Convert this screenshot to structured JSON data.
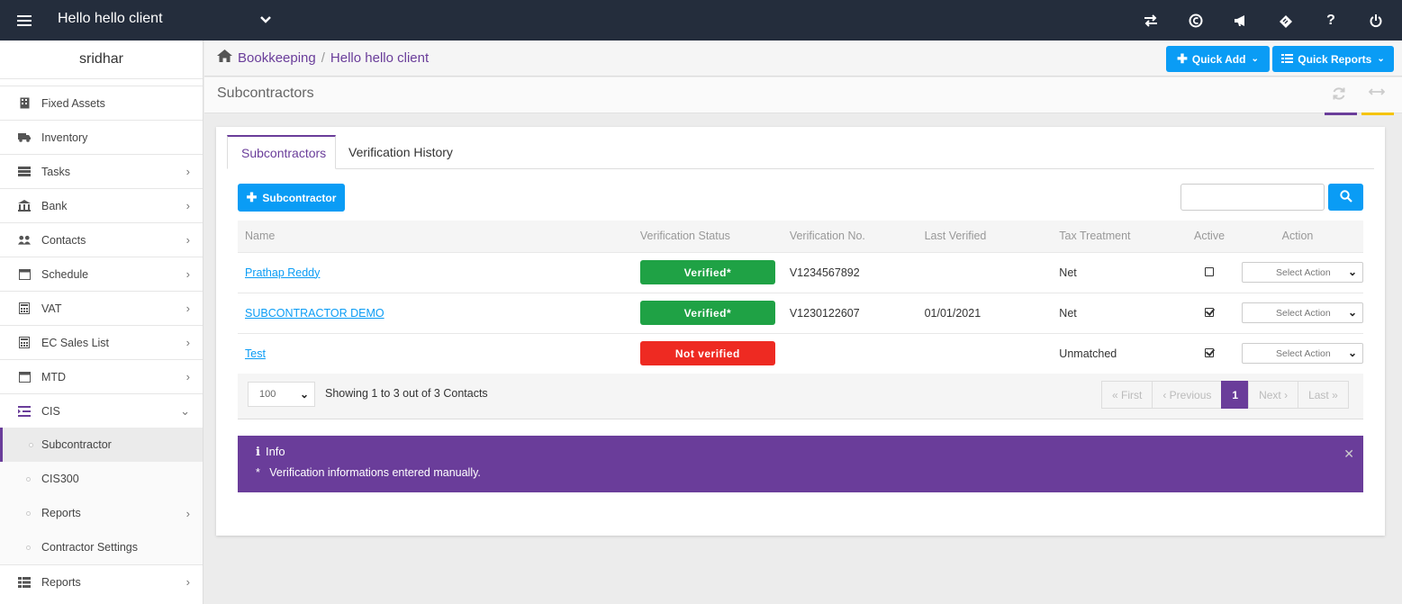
{
  "header": {
    "client_name": "Hello hello client",
    "icons": [
      "transfer-icon",
      "currency-icon",
      "announcement-icon",
      "ticket-icon",
      "help-icon",
      "power-icon"
    ]
  },
  "sidebar": {
    "user": "sridhar",
    "items": [
      {
        "label": "Fixed Assets",
        "icon": "building-icon",
        "has_chevron": false
      },
      {
        "label": "Inventory",
        "icon": "truck-icon",
        "has_chevron": false
      },
      {
        "label": "Tasks",
        "icon": "list-icon",
        "has_chevron": true
      },
      {
        "label": "Bank",
        "icon": "bank-icon",
        "has_chevron": true
      },
      {
        "label": "Contacts",
        "icon": "users-icon",
        "has_chevron": true
      },
      {
        "label": "Schedule",
        "icon": "calendar-icon",
        "has_chevron": true
      },
      {
        "label": "VAT",
        "icon": "calculator-icon",
        "has_chevron": true
      },
      {
        "label": "EC Sales List",
        "icon": "calculator-icon",
        "has_chevron": true
      },
      {
        "label": "MTD",
        "icon": "calendar-icon",
        "has_chevron": true
      },
      {
        "label": "CIS",
        "icon": "indent-icon",
        "has_chevron": true,
        "expanded": true
      }
    ],
    "cis_sub": [
      {
        "label": "Subcontractor",
        "active": true
      },
      {
        "label": "CIS300"
      },
      {
        "label": "Reports",
        "has_chevron": true
      },
      {
        "label": "Contractor Settings"
      }
    ],
    "bottom_item": {
      "label": "Reports",
      "icon": "table-icon"
    }
  },
  "breadcrumb": {
    "items": [
      "Bookkeeping",
      "Hello hello client"
    ],
    "separator": "/"
  },
  "toolbar": {
    "quick_add_label": "Quick Add",
    "quick_reports_label": "Quick Reports"
  },
  "page": {
    "title": "Subcontractors"
  },
  "tabs": [
    "Subcontractors",
    "Verification History"
  ],
  "actions": {
    "add_subcontractor_label": "Subcontractor"
  },
  "search": {
    "value": ""
  },
  "table": {
    "headers": [
      "Name",
      "Verification Status",
      "Verification No.",
      "Last Verified",
      "Tax Treatment",
      "Active",
      "Action"
    ],
    "rows": [
      {
        "name": "Prathap Reddy",
        "status": "Verified*",
        "status_color": "#1fa245",
        "verification_no": "V1234567892",
        "last_verified": "",
        "tax_treatment": "Net",
        "active": false,
        "action": "Select Action"
      },
      {
        "name": "SUBCONTRACTOR DEMO",
        "status": "Verified*",
        "status_color": "#1fa245",
        "verification_no": "V1230122607",
        "last_verified": "01/01/2021",
        "tax_treatment": "Net",
        "active": true,
        "action": "Select Action"
      },
      {
        "name": "Test",
        "status": "Not verified",
        "status_color": "#ee2a22",
        "verification_no": "",
        "last_verified": "",
        "tax_treatment": "Unmatched",
        "active": true,
        "action": "Select Action"
      }
    ]
  },
  "pagination": {
    "page_size": "100",
    "summary": "Showing 1 to 3 out of 3 Contacts",
    "first": "« First",
    "previous": "‹ Previous",
    "current": "1",
    "next": "Next ›",
    "last": "Last »"
  },
  "info": {
    "title": "Info",
    "text": "*   Verification informations entered manually."
  },
  "colors": {
    "topbar": "#242d3c",
    "accent_purple": "#6a3d9a",
    "accent_blue": "#0a9cf5",
    "accent_yellow": "#f5c400"
  }
}
